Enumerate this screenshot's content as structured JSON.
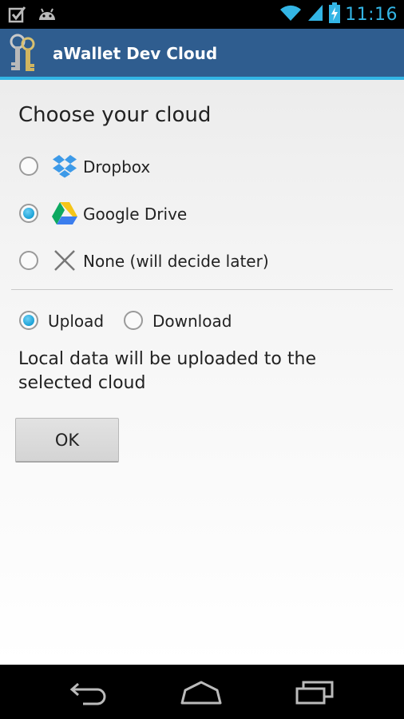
{
  "status_bar": {
    "time": "11:16",
    "icons": [
      "task-done-icon",
      "android-icon",
      "wifi-icon",
      "signal-icon",
      "battery-charging-icon"
    ]
  },
  "action_bar": {
    "title": "aWallet Dev Cloud",
    "app_icon": "keys-icon"
  },
  "main": {
    "heading": "Choose your cloud",
    "cloud_options": [
      {
        "label": "Dropbox",
        "icon": "dropbox-icon",
        "selected": false
      },
      {
        "label": "Google Drive",
        "icon": "google-drive-icon",
        "selected": true
      },
      {
        "label": "None (will decide later)",
        "icon": "close-icon",
        "selected": false
      }
    ],
    "direction_options": [
      {
        "label": "Upload",
        "selected": true
      },
      {
        "label": "Download",
        "selected": false
      }
    ],
    "message": "Local data will be uploaded to the selected cloud",
    "ok_label": "OK"
  },
  "nav_bar": {
    "icons": [
      "back-icon",
      "home-icon",
      "recent-apps-icon"
    ]
  },
  "colors": {
    "accent": "#33b5e5",
    "action_bar": "#2f5d8f",
    "radio_selected": "#1aa1d6"
  }
}
